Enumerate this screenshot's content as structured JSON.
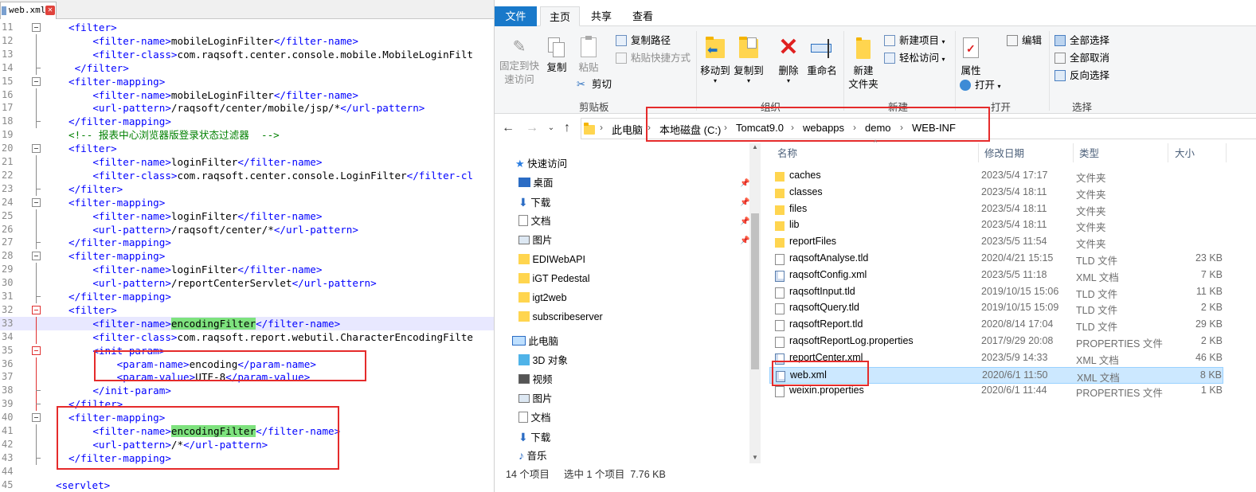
{
  "editor": {
    "tab_label": "web.xml",
    "lines": [
      {
        "n": "11",
        "seg": [
          [
            "tg",
            "<filter>"
          ]
        ]
      },
      {
        "n": "12",
        "seg": [
          [
            "tg",
            "    <filter-name>"
          ],
          [
            "tx",
            "mobileLoginFilter"
          ],
          [
            "tg",
            "</filter-name>"
          ]
        ]
      },
      {
        "n": "13",
        "seg": [
          [
            "tg",
            "    <filter-class>"
          ],
          [
            "tx",
            "com.raqsoft.center.console.mobile.MobileLoginFilt"
          ]
        ]
      },
      {
        "n": "14",
        "seg": [
          [
            "tg",
            " </filter>"
          ]
        ]
      },
      {
        "n": "15",
        "seg": [
          [
            "tg",
            "<filter-mapping>"
          ]
        ]
      },
      {
        "n": "16",
        "seg": [
          [
            "tg",
            "    <filter-name>"
          ],
          [
            "tx",
            "mobileLoginFilter"
          ],
          [
            "tg",
            "</filter-name>"
          ]
        ]
      },
      {
        "n": "17",
        "seg": [
          [
            "tg",
            "    <url-pattern>"
          ],
          [
            "tx",
            "/raqsoft/center/mobile/jsp/*"
          ],
          [
            "tg",
            "</url-pattern>"
          ]
        ]
      },
      {
        "n": "18",
        "seg": [
          [
            "tg",
            "</filter-mapping>"
          ]
        ]
      },
      {
        "n": "19",
        "seg": [
          [
            "cm",
            "<!-- 报表中心浏览器版登录状态过滤器  -->"
          ]
        ]
      },
      {
        "n": "20",
        "seg": [
          [
            "tg",
            "<filter>"
          ]
        ]
      },
      {
        "n": "21",
        "seg": [
          [
            "tg",
            "    <filter-name>"
          ],
          [
            "tx",
            "loginFilter"
          ],
          [
            "tg",
            "</filter-name>"
          ]
        ]
      },
      {
        "n": "22",
        "seg": [
          [
            "tg",
            "    <filter-class>"
          ],
          [
            "tx",
            "com.raqsoft.center.console.LoginFilter"
          ],
          [
            "tg",
            "</filter-cl"
          ]
        ]
      },
      {
        "n": "23",
        "seg": [
          [
            "tg",
            "</filter>"
          ]
        ]
      },
      {
        "n": "24",
        "seg": [
          [
            "tg",
            "<filter-mapping>"
          ]
        ]
      },
      {
        "n": "25",
        "seg": [
          [
            "tg",
            "    <filter-name>"
          ],
          [
            "tx",
            "loginFilter"
          ],
          [
            "tg",
            "</filter-name>"
          ]
        ]
      },
      {
        "n": "26",
        "seg": [
          [
            "tg",
            "    <url-pattern>"
          ],
          [
            "tx",
            "/raqsoft/center/*"
          ],
          [
            "tg",
            "</url-pattern>"
          ]
        ]
      },
      {
        "n": "27",
        "seg": [
          [
            "tg",
            "</filter-mapping>"
          ]
        ]
      },
      {
        "n": "28",
        "seg": [
          [
            "tg",
            "<filter-mapping>"
          ]
        ]
      },
      {
        "n": "29",
        "seg": [
          [
            "tg",
            "    <filter-name>"
          ],
          [
            "tx",
            "loginFilter"
          ],
          [
            "tg",
            "</filter-name>"
          ]
        ]
      },
      {
        "n": "30",
        "seg": [
          [
            "tg",
            "    <url-pattern>"
          ],
          [
            "tx",
            "/reportCenterServlet"
          ],
          [
            "tg",
            "</url-pattern>"
          ]
        ]
      },
      {
        "n": "31",
        "seg": [
          [
            "tg",
            "</filter-mapping>"
          ]
        ]
      },
      {
        "n": "32",
        "seg": [
          [
            "tg",
            "<filter>"
          ]
        ]
      },
      {
        "n": "33",
        "seg": [
          [
            "tg",
            "    <filter-name>"
          ],
          [
            "hl",
            "encodingFilter"
          ],
          [
            "tg",
            "</filter-name>"
          ]
        ]
      },
      {
        "n": "34",
        "seg": [
          [
            "tg",
            "    <filter-class>"
          ],
          [
            "tx",
            "com.raqsoft.report.webutil.CharacterEncodingFilte"
          ]
        ]
      },
      {
        "n": "35",
        "seg": [
          [
            "tg",
            "    <init-param>"
          ]
        ]
      },
      {
        "n": "36",
        "seg": [
          [
            "tg",
            "        <param-name>"
          ],
          [
            "tx",
            "encoding"
          ],
          [
            "tg",
            "</param-name>"
          ]
        ]
      },
      {
        "n": "37",
        "seg": [
          [
            "tg",
            "        <param-value>"
          ],
          [
            "tx",
            "UTF-8"
          ],
          [
            "tg",
            "</param-value>"
          ]
        ]
      },
      {
        "n": "38",
        "seg": [
          [
            "tg",
            "    </init-param>"
          ]
        ]
      },
      {
        "n": "39",
        "seg": [
          [
            "tg",
            "</filter>"
          ]
        ]
      },
      {
        "n": "40",
        "seg": [
          [
            "tg",
            "<filter-mapping>"
          ]
        ]
      },
      {
        "n": "41",
        "seg": [
          [
            "tg",
            "    <filter-name>"
          ],
          [
            "hl",
            "encodingFilter"
          ],
          [
            "tg",
            "</filter-name>"
          ]
        ]
      },
      {
        "n": "42",
        "seg": [
          [
            "tg",
            "    <url-pattern>"
          ],
          [
            "tx",
            "/*"
          ],
          [
            "tg",
            "</url-pattern>"
          ]
        ]
      },
      {
        "n": "43",
        "seg": [
          [
            "tg",
            "</filter-mapping>"
          ]
        ]
      },
      {
        "n": "44",
        "seg": [
          [
            "tg",
            ""
          ]
        ]
      },
      {
        "n": "45",
        "seg": [
          [
            "tg",
            "<servlet>"
          ]
        ]
      }
    ]
  },
  "explorer": {
    "ribbon_tabs": {
      "file": "文件",
      "home": "主页",
      "share": "共享",
      "view": "查看"
    },
    "clipboard": {
      "pin": "固定到快速访问",
      "copy": "复制",
      "paste": "粘贴",
      "copy_path": "复制路径",
      "paste_shortcut": "粘贴快捷方式",
      "cut": "剪切",
      "label": "剪贴板"
    },
    "organize": {
      "move_to": "移动到",
      "copy_to": "复制到",
      "delete": "删除",
      "rename": "重命名",
      "label": "组织"
    },
    "new": {
      "new_folder": "新建\n文件夹",
      "new_item": "新建项目",
      "easy_access": "轻松访问",
      "label": "新建"
    },
    "open": {
      "properties": "属性",
      "open": "打开",
      "edit": "编辑",
      "label": "打开"
    },
    "select": {
      "select_all": "全部选择",
      "select_none": "全部取消",
      "invert": "反向选择",
      "label": "选择"
    },
    "breadcrumb": [
      "此电脑",
      "本地磁盘 (C:)",
      "Tomcat9.0",
      "webapps",
      "demo",
      "WEB-INF"
    ],
    "nav": {
      "quick_access": "快速访问",
      "pinned": [
        "桌面",
        "下载",
        "文档",
        "图片"
      ],
      "recent": [
        "EDIWebAPI",
        "iGT Pedestal",
        "igt2web",
        "subscribeserver"
      ],
      "this_pc": "此电脑",
      "pc_items": [
        "3D 对象",
        "视频",
        "图片",
        "文档",
        "下载",
        "音乐"
      ]
    },
    "columns": {
      "name": "名称",
      "date": "修改日期",
      "type": "类型",
      "size": "大小"
    },
    "files": [
      {
        "name": "caches",
        "date": "2023/5/4 17:17",
        "type": "文件夹",
        "size": "",
        "kind": "folder"
      },
      {
        "name": "classes",
        "date": "2023/5/4 18:11",
        "type": "文件夹",
        "size": "",
        "kind": "folder"
      },
      {
        "name": "files",
        "date": "2023/5/4 18:11",
        "type": "文件夹",
        "size": "",
        "kind": "folder"
      },
      {
        "name": "lib",
        "date": "2023/5/4 18:11",
        "type": "文件夹",
        "size": "",
        "kind": "folder"
      },
      {
        "name": "reportFiles",
        "date": "2023/5/5 11:54",
        "type": "文件夹",
        "size": "",
        "kind": "folder"
      },
      {
        "name": "raqsoftAnalyse.tld",
        "date": "2020/4/21 15:15",
        "type": "TLD 文件",
        "size": "23 KB",
        "kind": "doc"
      },
      {
        "name": "raqsoftConfig.xml",
        "date": "2023/5/5 11:18",
        "type": "XML 文档",
        "size": "7 KB",
        "kind": "xml"
      },
      {
        "name": "raqsoftInput.tld",
        "date": "2019/10/15 15:06",
        "type": "TLD 文件",
        "size": "11 KB",
        "kind": "doc"
      },
      {
        "name": "raqsoftQuery.tld",
        "date": "2019/10/15 15:09",
        "type": "TLD 文件",
        "size": "2 KB",
        "kind": "doc"
      },
      {
        "name": "raqsoftReport.tld",
        "date": "2020/8/14 17:04",
        "type": "TLD 文件",
        "size": "29 KB",
        "kind": "doc"
      },
      {
        "name": "raqsoftReportLog.properties",
        "date": "2017/9/29 20:08",
        "type": "PROPERTIES 文件",
        "size": "2 KB",
        "kind": "doc"
      },
      {
        "name": "reportCenter.xml",
        "date": "2023/5/9 14:33",
        "type": "XML 文档",
        "size": "46 KB",
        "kind": "xml"
      },
      {
        "name": "web.xml",
        "date": "2020/6/1 11:50",
        "type": "XML 文档",
        "size": "8 KB",
        "kind": "xml",
        "selected": true
      },
      {
        "name": "weixin.properties",
        "date": "2020/6/1 11:44",
        "type": "PROPERTIES 文件",
        "size": "1 KB",
        "kind": "doc"
      }
    ],
    "status": {
      "count": "14 个项目",
      "selected": "选中 1 个项目  7.76 KB"
    },
    "colors": {
      "accent": "#1979ca",
      "selection": "#cce8ff",
      "highlight": "#e52b2b"
    }
  }
}
